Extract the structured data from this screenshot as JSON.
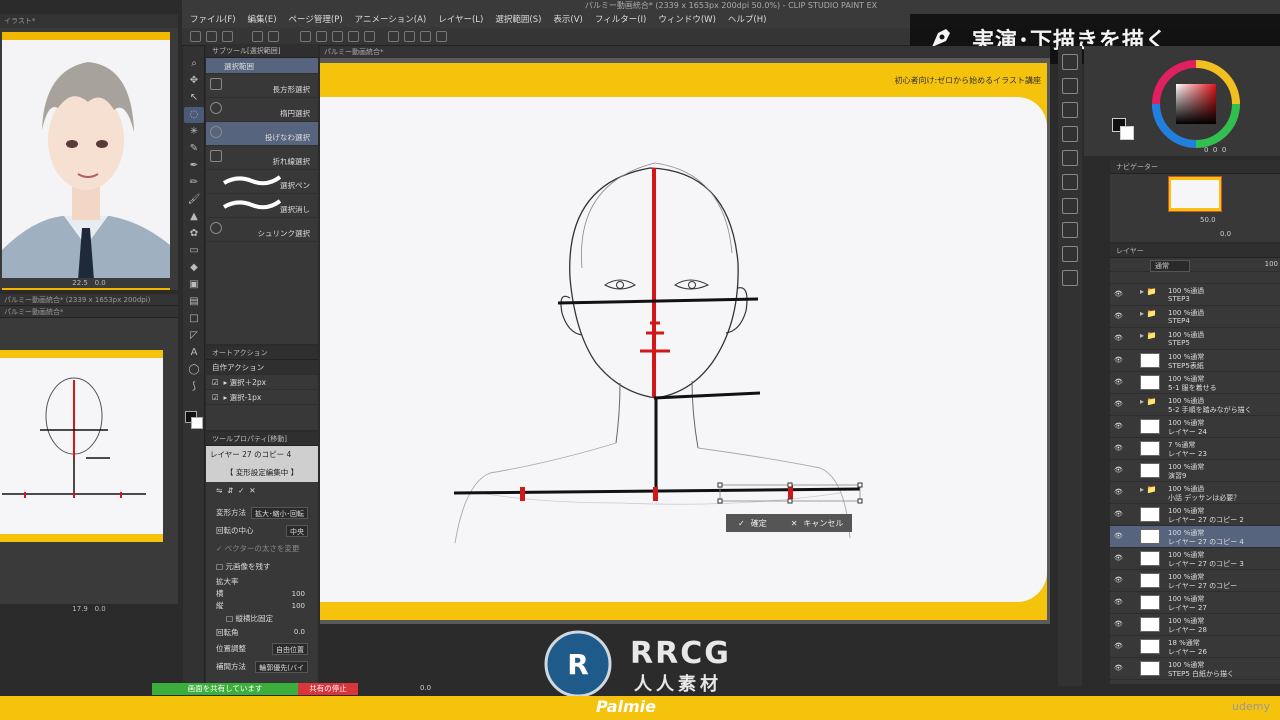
{
  "window": {
    "title": "パルミー動画統合* (2339 x 1653px 200dpi 50.0%) - CLIP STUDIO PAINT EX"
  },
  "menu": [
    "ファイル(F)",
    "編集(E)",
    "ページ管理(P)",
    "アニメーション(A)",
    "レイヤー(L)",
    "選択範囲(S)",
    "表示(V)",
    "フィルター(I)",
    "ウィンドウ(W)",
    "ヘルプ(H)"
  ],
  "banner": {
    "title": "実演･下描きを描く"
  },
  "preview1": {
    "tab": "イラスト*",
    "zoom": "22.5",
    "angle": "0.0"
  },
  "preview2": {
    "tab1": "パルミー動画統合* (2339 x 1653px 200dpi)",
    "tab2": "パルミー動画統合*",
    "zoom": "17.9",
    "angle": "0.0"
  },
  "subtool": {
    "header": "サブツール[選択範囲]",
    "items": [
      "選択範囲",
      "長方形選択",
      "楕円選択",
      "投げなわ選択",
      "折れ線選択",
      "選択ペン",
      "選択消し",
      "シュリンク選択"
    ]
  },
  "autoaction": {
    "header": "オートアクション",
    "set": "自作アクション",
    "items": [
      "選択＋2px",
      "選択-1px"
    ]
  },
  "toolprop": {
    "header": "ツールプロパティ[移動]",
    "layer": "レイヤー 27 のコピー 4",
    "mode": "【 変形設定編集中 】",
    "rows": [
      {
        "label": "変形方法",
        "value": "拡大･縮小･回転"
      },
      {
        "label": "回転の中心",
        "value": "中央"
      }
    ],
    "vector_label": "ベクターの太さを変更",
    "keep_original": "元画像を残す",
    "scale_label": "拡大率",
    "width_label": "横",
    "width_value": "100",
    "height_label": "縦",
    "height_value": "100",
    "fix_ratio": "縦横比固定",
    "rotate_label": "回転角",
    "rotate_value": "0.0",
    "pos_label": "位置調整",
    "pos_value": "自由位置",
    "interp_label": "補間方法",
    "interp_value": "輪郭優先(バイ"
  },
  "canvas": {
    "tab": "パルミー動画統合*",
    "course": "初心者向け:ゼロから始めるイラスト講座"
  },
  "confirm": {
    "ok": "確定",
    "cancel": "キャンセル"
  },
  "color": {
    "values": [
      "0",
      "0",
      "0"
    ]
  },
  "navigator": {
    "header": "ナビゲーター",
    "zoom": "50.0",
    "angle": "0.0"
  },
  "layers": {
    "header": "レイヤー",
    "blend": "通常",
    "opacity": "100",
    "items": [
      {
        "l1": "100 %通過",
        "l2": "STEP3",
        "type": "folder"
      },
      {
        "l1": "100 %通過",
        "l2": "STEP4",
        "type": "folder"
      },
      {
        "l1": "100 %通過",
        "l2": "STEP5",
        "type": "folder"
      },
      {
        "l1": "100 %通常",
        "l2": "STEP5表紙",
        "type": "layer"
      },
      {
        "l1": "100 %通常",
        "l2": "5-1 服を着せる",
        "type": "layer"
      },
      {
        "l1": "100 %通過",
        "l2": "5-2 手順を踏みながら描く",
        "type": "folder"
      },
      {
        "l1": "100 %通常",
        "l2": "レイヤー 24",
        "type": "layer"
      },
      {
        "l1": "7 %通常",
        "l2": "レイヤー 23",
        "type": "layer"
      },
      {
        "l1": "100 %通常",
        "l2": "演習9",
        "type": "layer"
      },
      {
        "l1": "100 %通過",
        "l2": "小話 デッサンは必要？",
        "type": "folder"
      },
      {
        "l1": "100 %通常",
        "l2": "レイヤー 27 のコピー 2",
        "type": "layer"
      },
      {
        "l1": "100 %通常",
        "l2": "レイヤー 27 のコピー 4",
        "type": "layer",
        "selected": true
      },
      {
        "l1": "100 %通常",
        "l2": "レイヤー 27 のコピー 3",
        "type": "layer"
      },
      {
        "l1": "100 %通常",
        "l2": "レイヤー 27 のコピー",
        "type": "layer"
      },
      {
        "l1": "100 %通常",
        "l2": "レイヤー 27",
        "type": "layer"
      },
      {
        "l1": "100 %通常",
        "l2": "レイヤー 28",
        "type": "layer"
      },
      {
        "l1": "18 %通常",
        "l2": "レイヤー 26",
        "type": "layer"
      },
      {
        "l1": "100 %通常",
        "l2": "STEP5 白紙から描く",
        "type": "layer"
      }
    ]
  },
  "share": {
    "sharing": "画面を共有しています",
    "stop": "共有の停止"
  },
  "footer": {
    "watermark_top": "RRCG",
    "watermark_bottom": "人人素材",
    "palmie": "Palmie",
    "udemy": "udemy",
    "bottom_zoom": "0.0"
  },
  "colors": {
    "accent_yellow": "#f5c20c",
    "selection": "#57647e",
    "red_mark": "#d01818",
    "share_green": "#3cae3c",
    "share_red": "#d8363a"
  }
}
